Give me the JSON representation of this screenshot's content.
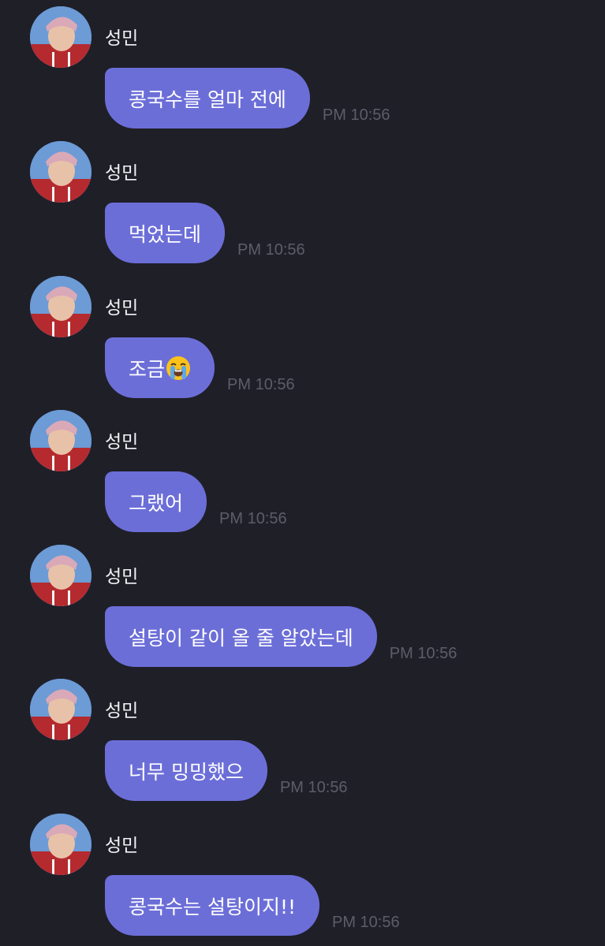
{
  "chat": {
    "bubble_color": "#6c6ed8",
    "background_color": "#1f1f28",
    "messages": [
      {
        "sender": "성민",
        "text": "콩국수를 얼마 전에",
        "time": "PM 10:56",
        "avatar": "profile-avatar"
      },
      {
        "sender": "성민",
        "text": "먹었는데",
        "time": "PM 10:56",
        "avatar": "profile-avatar"
      },
      {
        "sender": "성민",
        "text": "조금",
        "emoji": "loudly-crying-face-emoji",
        "time": "PM 10:56",
        "avatar": "profile-avatar"
      },
      {
        "sender": "성민",
        "text": "그랬어",
        "time": "PM 10:56",
        "avatar": "profile-avatar"
      },
      {
        "sender": "성민",
        "text": "설탕이 같이 올 줄 알았는데",
        "time": "PM 10:56",
        "avatar": "profile-avatar"
      },
      {
        "sender": "성민",
        "text": "너무 밍밍했으",
        "time": "PM 10:56",
        "avatar": "profile-avatar"
      },
      {
        "sender": "성민",
        "text": "콩국수는 설탕이지!!",
        "time": "PM 10:56",
        "avatar": "profile-avatar"
      }
    ]
  }
}
